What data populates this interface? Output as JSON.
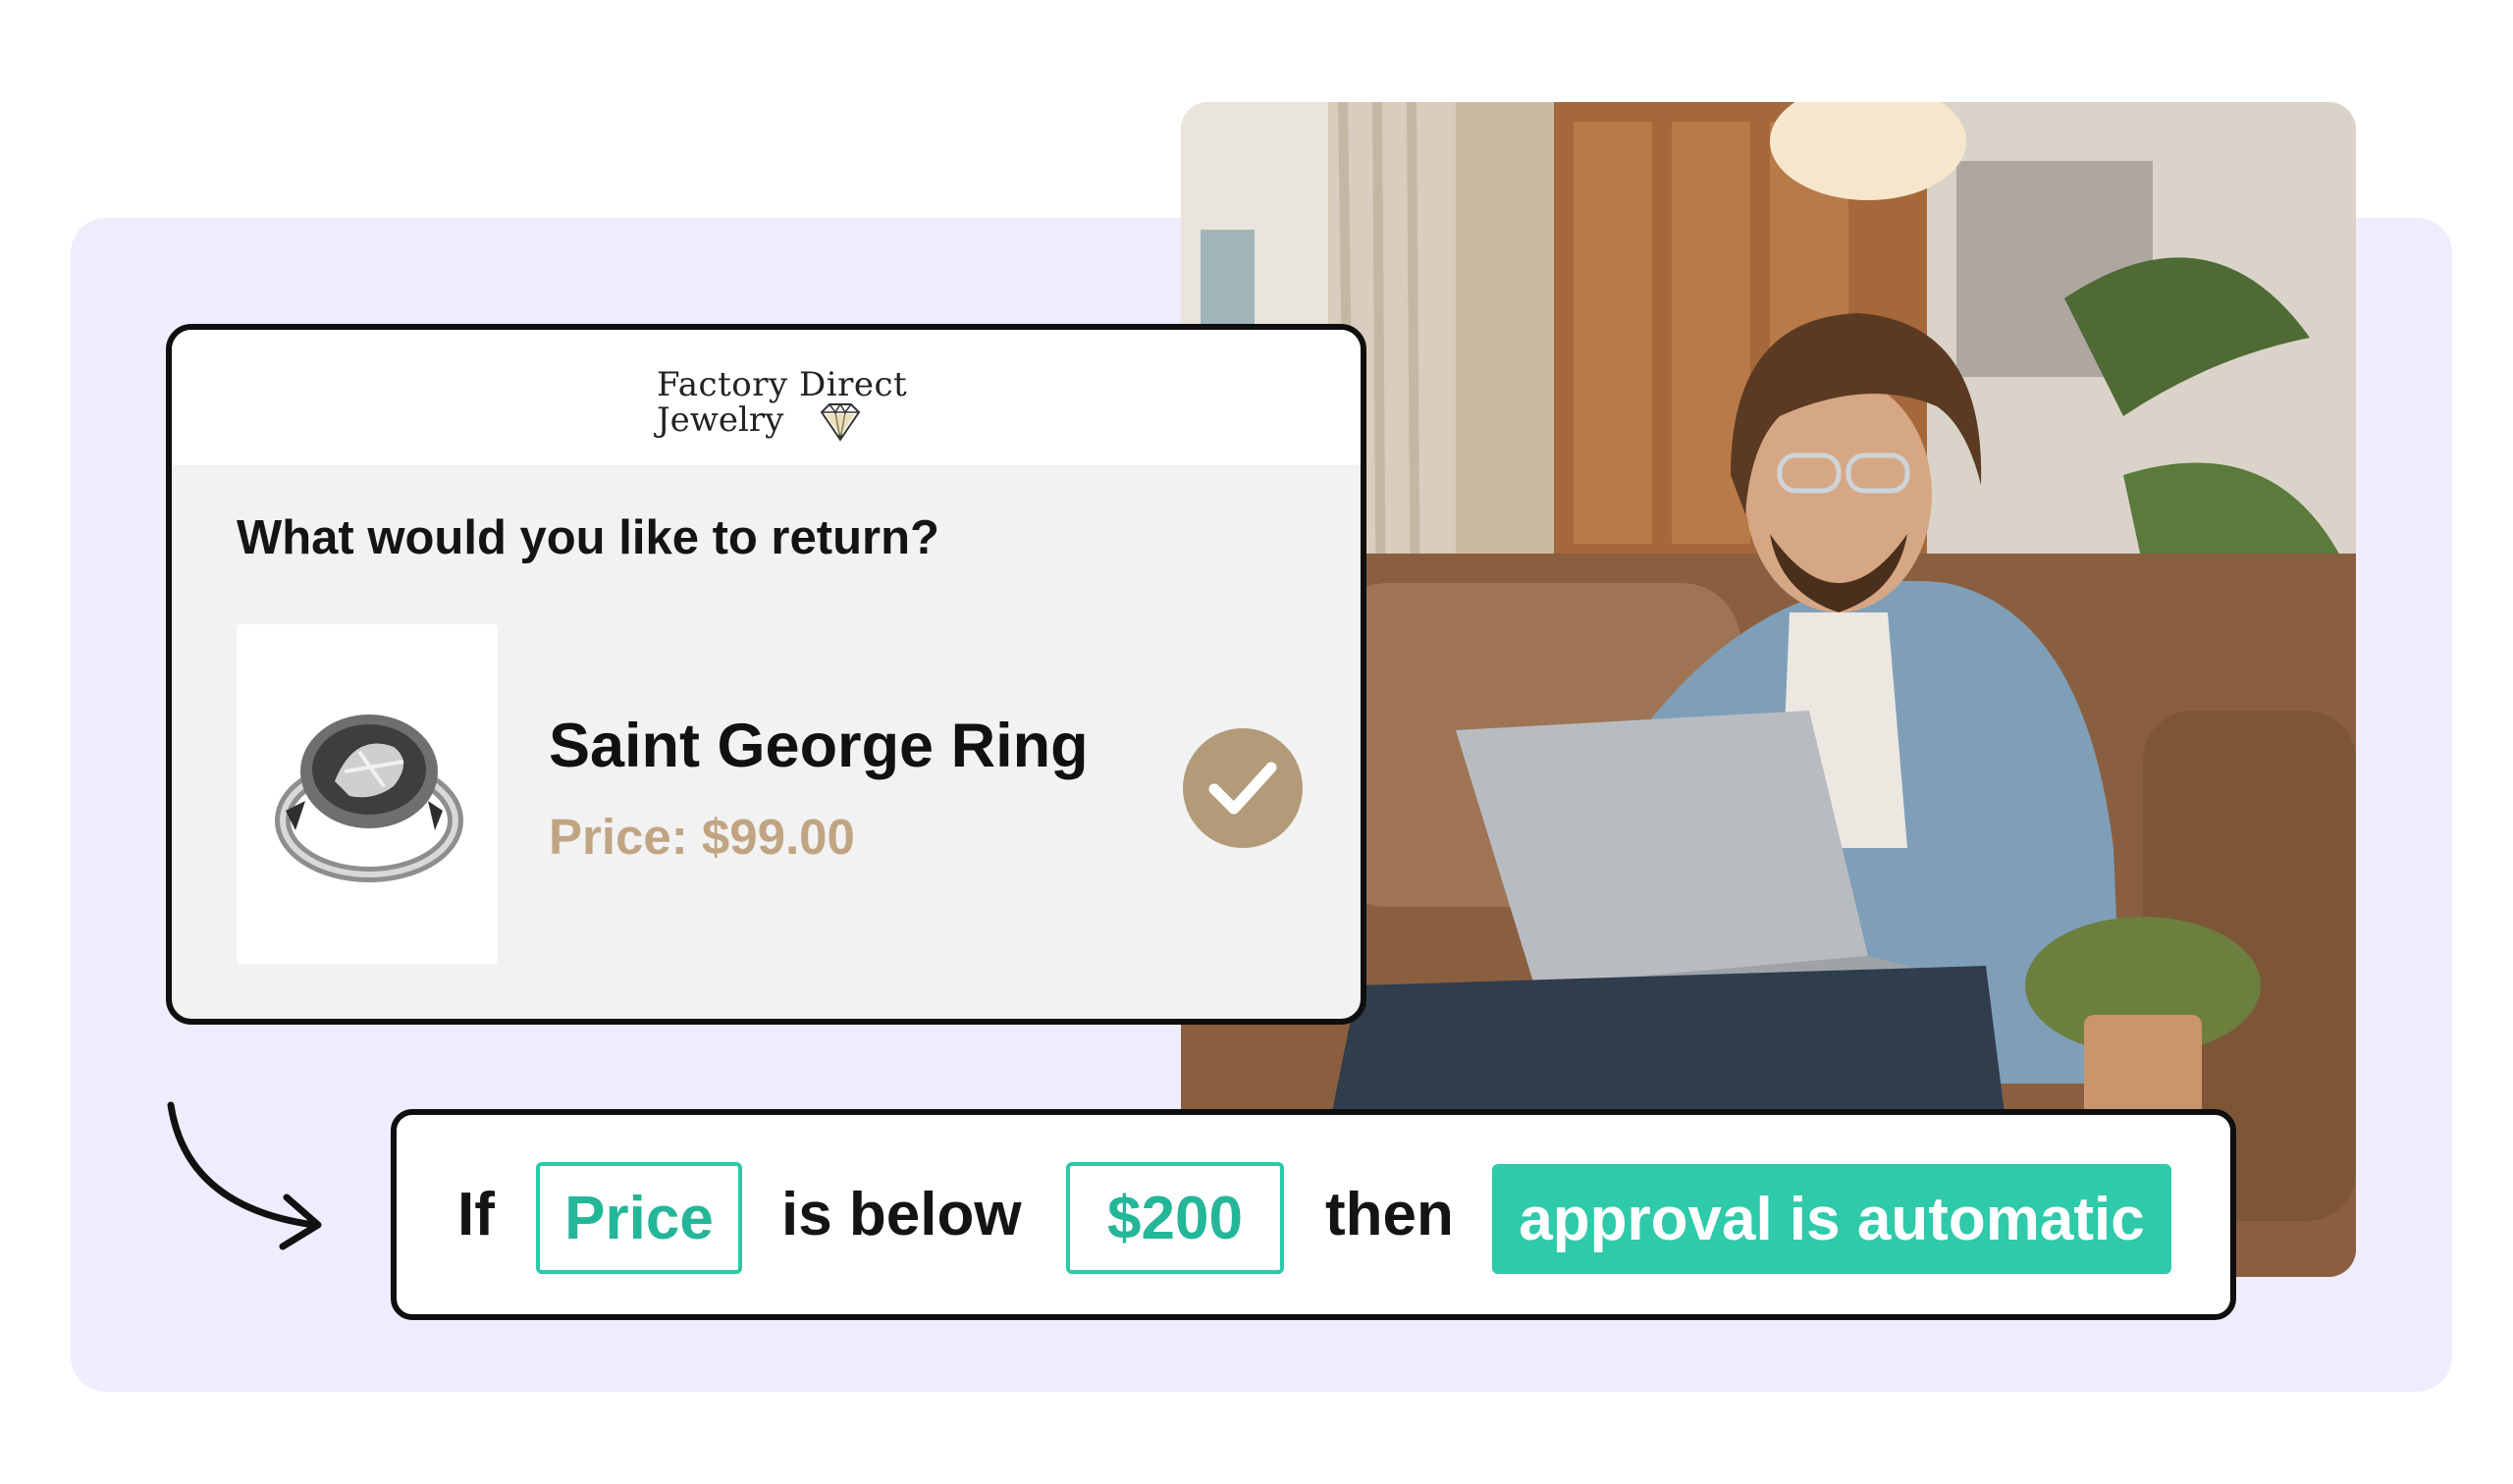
{
  "brand": {
    "line1": "Factory Direct",
    "line2": "Jewelry"
  },
  "returns": {
    "question": "What would you like to return?",
    "item": {
      "name": "Saint George Ring",
      "price": "Price: $99.00",
      "selected": true
    }
  },
  "rule": {
    "if_label": "If",
    "field": "Price",
    "operator": "is below",
    "value": "$200",
    "then_label": "then",
    "action": "approval is automatic"
  },
  "colors": {
    "accent_teal": "#2ecaa9",
    "accent_gold": "#b39a79",
    "price_gold": "#c1a583",
    "panel_lavender": "#efecfd"
  },
  "icons": {
    "check": "check-icon",
    "diamond": "diamond-icon",
    "arrow": "curved-arrow-icon",
    "ring": "ring-image"
  }
}
